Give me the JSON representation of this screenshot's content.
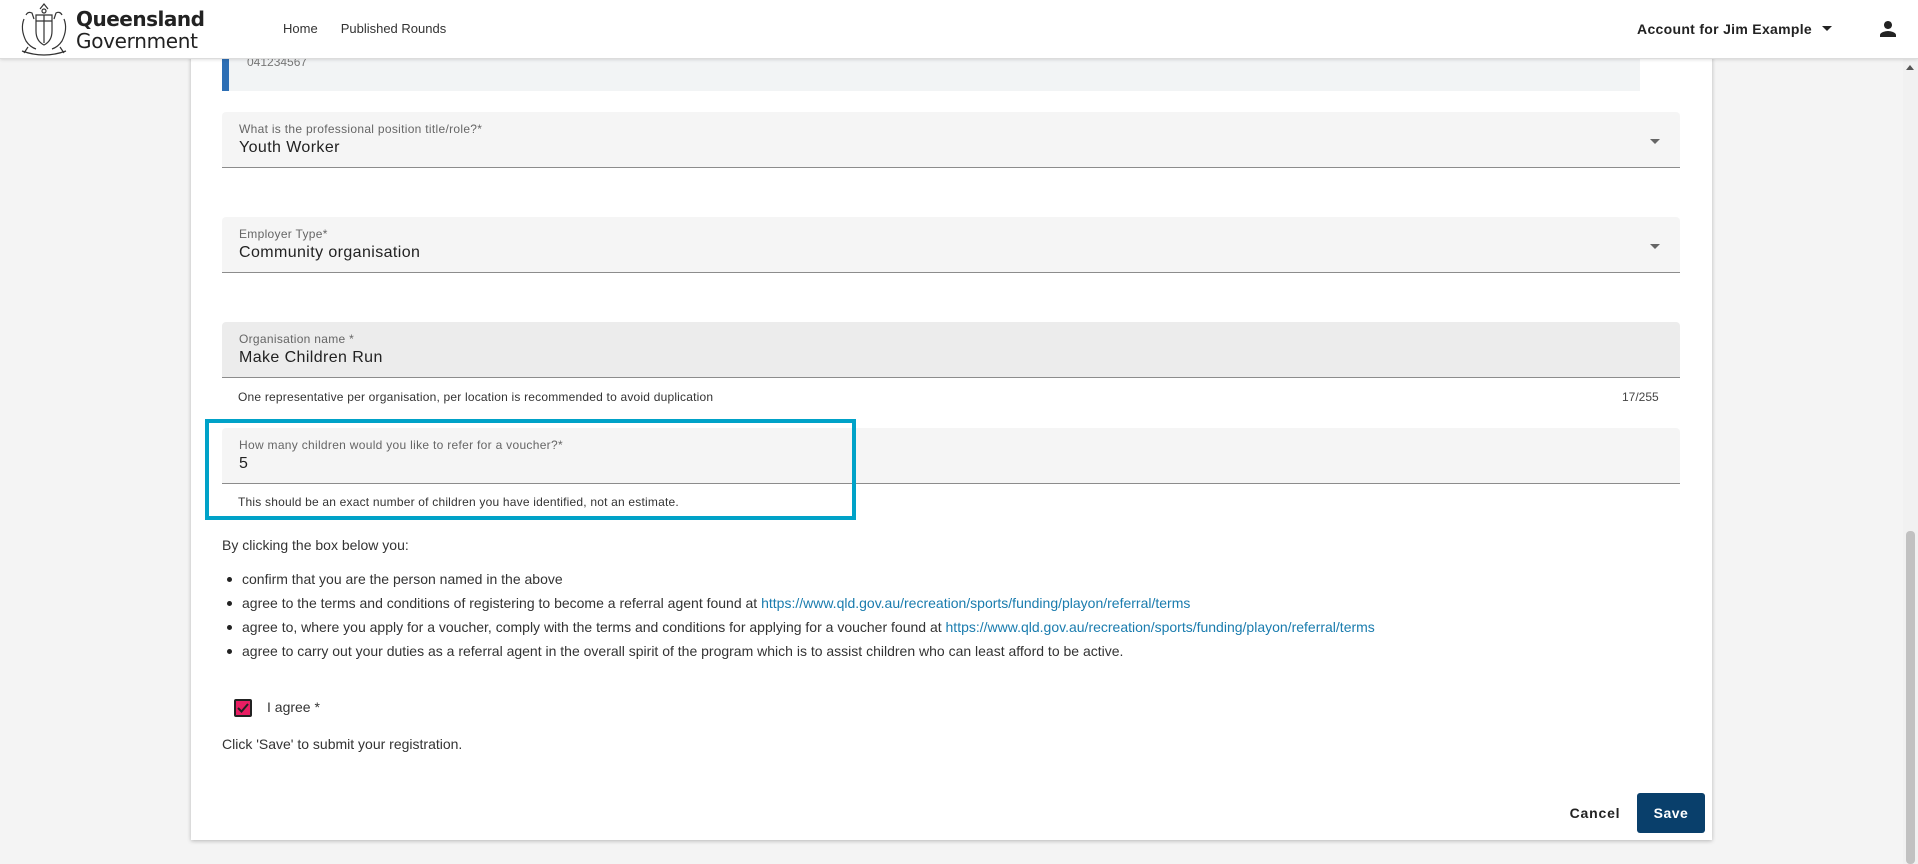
{
  "header": {
    "logo_line1": "Queensland",
    "logo_line2": "Government",
    "nav": [
      "Home",
      "Published Rounds"
    ],
    "account_label": "Account for Jim Example"
  },
  "form": {
    "phone_value": "041234567",
    "position": {
      "label": "What is the professional position title/role?*",
      "value": "Youth Worker"
    },
    "employer_type": {
      "label": "Employer Type*",
      "value": "Community organisation"
    },
    "organisation": {
      "label": "Organisation name *",
      "value": "Make Children Run",
      "hint": "One representative per organisation, per location is recommended to avoid duplication",
      "counter": "17/255"
    },
    "children": {
      "label": "How many children would you like to refer for a voucher?*",
      "value": "5",
      "hint": "This should be an exact number of children you have identified, not an estimate."
    },
    "consent": {
      "intro": "By clicking the box below you:",
      "items": [
        {
          "text": "confirm that you are the person named in the above",
          "link": ""
        },
        {
          "text": "agree to the terms and conditions of registering to become a referral agent found at ",
          "link": "https://www.qld.gov.au/recreation/sports/funding/playon/referral/terms"
        },
        {
          "text": "agree to, where you apply for a voucher, comply with the terms and conditions for applying for a voucher found at ",
          "link": "https://www.qld.gov.au/recreation/sports/funding/playon/referral/terms"
        },
        {
          "text": "agree to carry out your duties as a referral agent in the overall spirit of the program which is to assist children who can least afford to be active.",
          "link": ""
        }
      ],
      "agree_label": "I agree *",
      "agree_checked": true,
      "save_note": "Click 'Save' to submit your registration."
    },
    "buttons": {
      "cancel": "Cancel",
      "save": "Save"
    }
  },
  "colors": {
    "save_button": "#093f6b",
    "checkbox": "#e91e63",
    "highlight_border": "#00a2c8",
    "link": "#1a7cae",
    "phone_accent": "#2d6fb5"
  }
}
